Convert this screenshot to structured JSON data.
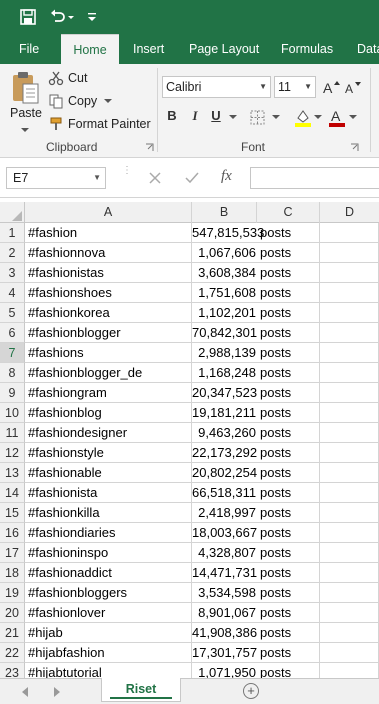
{
  "ribbon_tabs": [
    "File",
    "Home",
    "Insert",
    "Page Layout",
    "Formulas",
    "Data"
  ],
  "clipboard": {
    "paste": "Paste",
    "cut": "Cut",
    "copy": "Copy",
    "format_painter": "Format Painter",
    "group_label": "Clipboard"
  },
  "font": {
    "family": "Calibri",
    "size": "11",
    "bold": "B",
    "italic": "I",
    "underline": "U",
    "group_label": "Font"
  },
  "formula_bar": {
    "name_box": "E7",
    "fx": "fx",
    "value": ""
  },
  "columns": [
    "A",
    "B",
    "C",
    "D"
  ],
  "selected_row": 7,
  "rows": [
    {
      "n": "1",
      "tag": "#fashion",
      "count": "547,815,533",
      "unit": "posts"
    },
    {
      "n": "2",
      "tag": "#fashionnova",
      "count": "1,067,606",
      "unit": "posts"
    },
    {
      "n": "3",
      "tag": "#fashionistas",
      "count": "3,608,384",
      "unit": "posts"
    },
    {
      "n": "4",
      "tag": "#fashionshoes",
      "count": "1,751,608",
      "unit": "posts"
    },
    {
      "n": "5",
      "tag": "#fashionkorea",
      "count": "1,102,201",
      "unit": "posts"
    },
    {
      "n": "6",
      "tag": "#fashionblogger",
      "count": "70,842,301",
      "unit": "posts"
    },
    {
      "n": "7",
      "tag": "#fashions",
      "count": "2,988,139",
      "unit": "posts"
    },
    {
      "n": "8",
      "tag": "#fashionblogger_de",
      "count": "1,168,248",
      "unit": "posts"
    },
    {
      "n": "9",
      "tag": "#fashiongram",
      "count": "20,347,523",
      "unit": "posts"
    },
    {
      "n": "10",
      "tag": "#fashionblog",
      "count": "19,181,211",
      "unit": "posts"
    },
    {
      "n": "11",
      "tag": "#fashiondesigner",
      "count": "9,463,260",
      "unit": "posts"
    },
    {
      "n": "12",
      "tag": "#fashionstyle",
      "count": "22,173,292",
      "unit": "posts"
    },
    {
      "n": "13",
      "tag": "#fashionable",
      "count": "20,802,254",
      "unit": "posts"
    },
    {
      "n": "14",
      "tag": "#fashionista",
      "count": "66,518,311",
      "unit": "posts"
    },
    {
      "n": "15",
      "tag": "#fashionkilla",
      "count": "2,418,997",
      "unit": "posts"
    },
    {
      "n": "16",
      "tag": "#fashiondiaries",
      "count": "18,003,667",
      "unit": "posts"
    },
    {
      "n": "17",
      "tag": "#fashioninspo",
      "count": "4,328,807",
      "unit": "posts"
    },
    {
      "n": "18",
      "tag": "#fashionaddict",
      "count": "14,471,731",
      "unit": "posts"
    },
    {
      "n": "19",
      "tag": "#fashionbloggers",
      "count": "3,534,598",
      "unit": "posts"
    },
    {
      "n": "20",
      "tag": "#fashionlover",
      "count": "8,901,067",
      "unit": "posts"
    },
    {
      "n": "21",
      "tag": "#hijab",
      "count": "41,908,386",
      "unit": "posts"
    },
    {
      "n": "22",
      "tag": "#hijabfashion",
      "count": "17,301,757",
      "unit": "posts"
    },
    {
      "n": "23",
      "tag": "#hijabtutorial",
      "count": "1,071,950",
      "unit": "posts"
    }
  ],
  "sheet_tabs": [
    "Riset Hashtag"
  ],
  "colors": {
    "excel_green": "#217346",
    "highlight_yellow": "#ffff00",
    "font_red": "#c00000"
  }
}
